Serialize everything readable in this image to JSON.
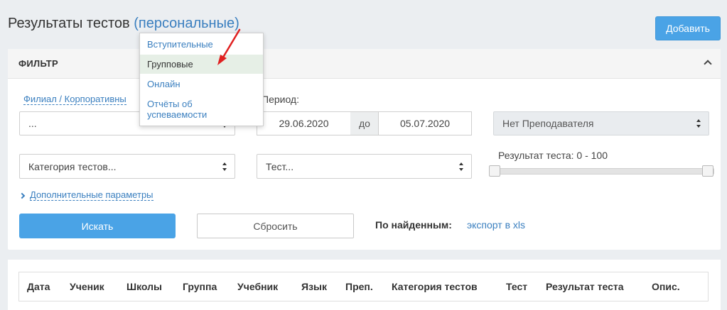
{
  "header": {
    "title": "Результаты тестов",
    "mode": "(персональные)",
    "add_label": "Добавить"
  },
  "filter": {
    "title": "ФИЛЬТР",
    "branch_label": "Филиал / Корпоративны",
    "branch_value": "...",
    "period_label": "Период:",
    "date_from": "29.06.2020",
    "date_sep": "до",
    "date_to": "05.07.2020",
    "teacher_value": "Нет Преподавателя",
    "category_value": "Категория тестов...",
    "test_value": "Тест...",
    "result_label": "Результат теста: 0 - 100",
    "result_range": [
      0,
      100
    ],
    "more_params": "Дополнительные параметры",
    "search_label": "Искать",
    "reset_label": "Сбросить",
    "found_label": "По найденным:",
    "export_label": "экспорт в xls"
  },
  "dropdown": {
    "items": [
      {
        "label": "Вступительные"
      },
      {
        "label": "Групповые"
      },
      {
        "label": "Онлайн"
      },
      {
        "label": "Отчёты об успеваемости"
      }
    ]
  },
  "table": {
    "columns": [
      "Дата",
      "Ученик",
      "Школы",
      "Группа",
      "Учебник",
      "Язык",
      "Преп.",
      "Категория тестов",
      "Тест",
      "Результат теста",
      "Опис."
    ]
  },
  "colors": {
    "accent": "#4aa3e6",
    "link": "#3a7fbf",
    "annotation_arrow": "#e02020"
  }
}
